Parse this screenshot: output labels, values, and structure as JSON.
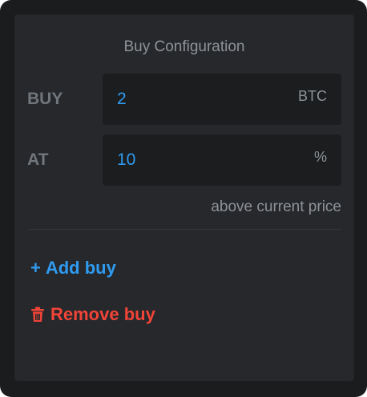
{
  "panel": {
    "title": "Buy Configuration"
  },
  "buy_row": {
    "label": "BUY",
    "value": "2",
    "unit": "BTC"
  },
  "at_row": {
    "label": "AT",
    "value": "10",
    "unit": "%",
    "hint": "above current price"
  },
  "actions": {
    "add_icon": "+",
    "add_label": "Add buy",
    "remove_label": "Remove buy",
    "remove_icon_name": "trash-icon"
  },
  "colors": {
    "accent_blue": "#2f9bf0",
    "danger_red": "#f04438",
    "panel_bg": "#26282b",
    "field_bg": "#1b1d1f",
    "muted_text": "#8e9398"
  }
}
